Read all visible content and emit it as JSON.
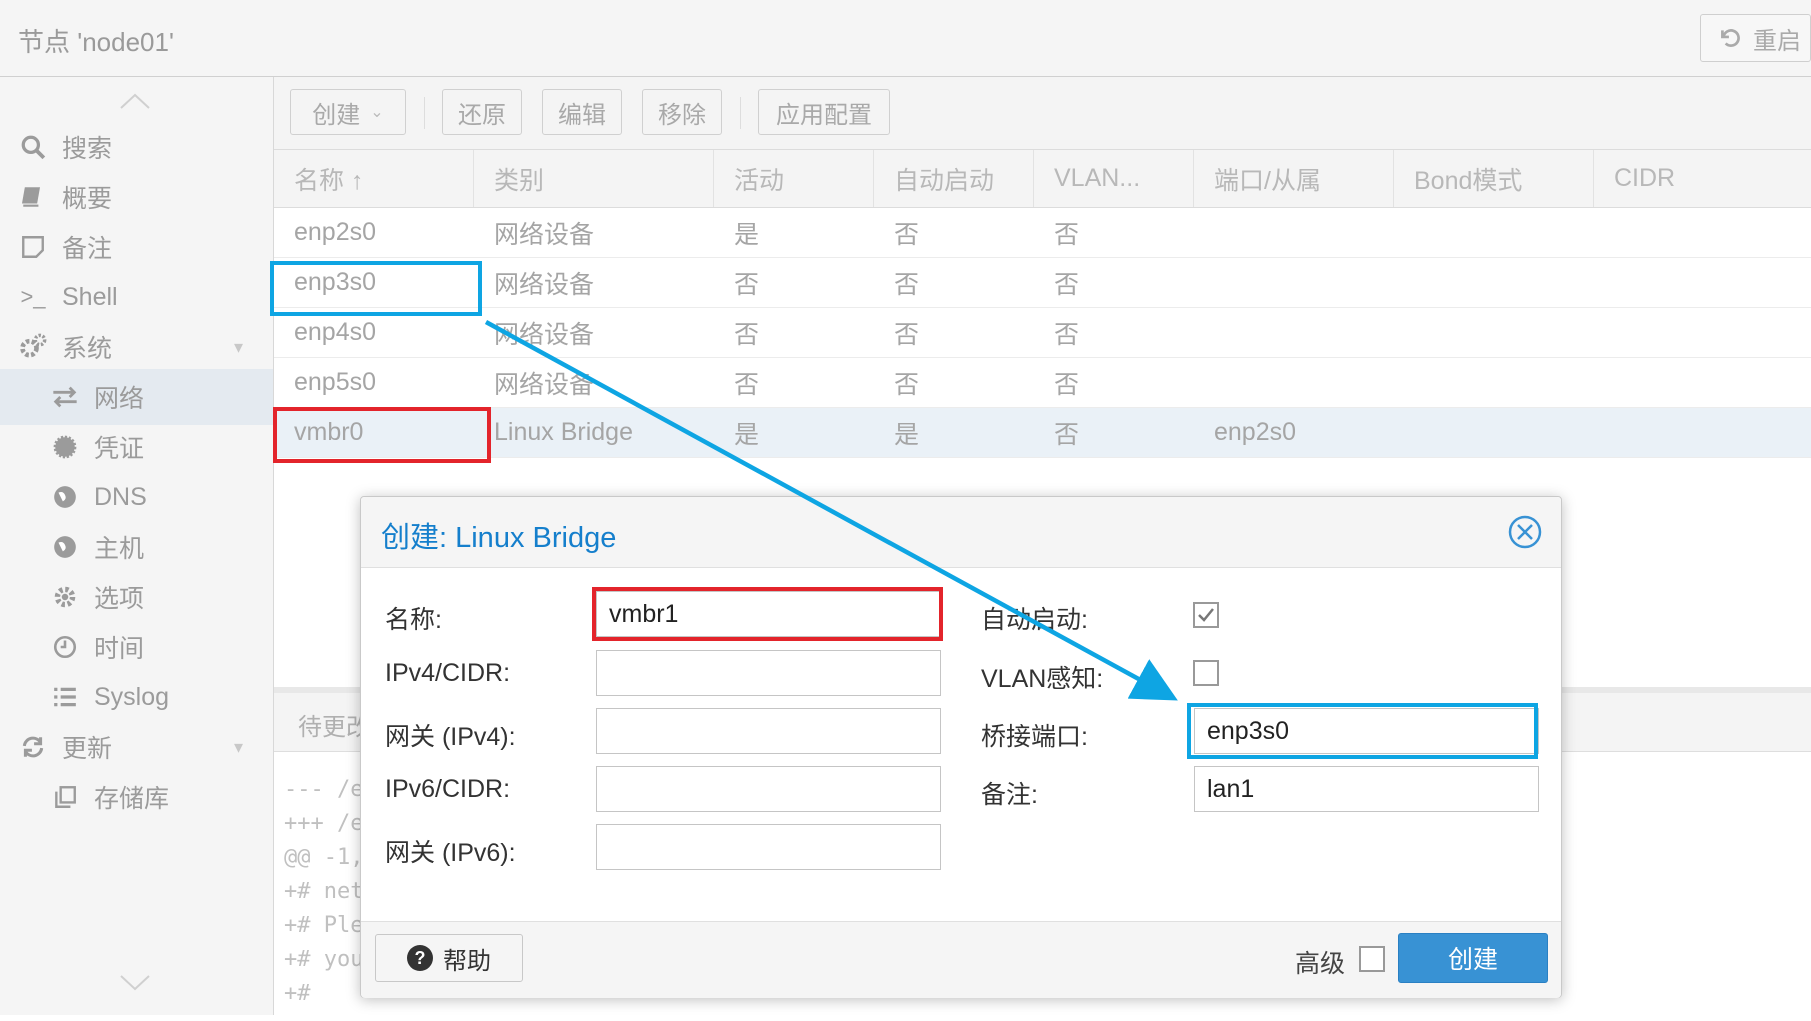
{
  "header": {
    "node_title": "节点 'node01'",
    "reboot_label": "重启"
  },
  "sidebar": {
    "items": [
      {
        "label": "搜索",
        "icon": "search-icon"
      },
      {
        "label": "概要",
        "icon": "book-icon"
      },
      {
        "label": "备注",
        "icon": "note-icon"
      },
      {
        "label": "Shell",
        "icon": "terminal-icon"
      },
      {
        "label": "系统",
        "icon": "gears-icon"
      },
      {
        "label": "网络",
        "icon": "exchange-icon"
      },
      {
        "label": "凭证",
        "icon": "certificate-icon"
      },
      {
        "label": "DNS",
        "icon": "globe-icon"
      },
      {
        "label": "主机",
        "icon": "globe-icon"
      },
      {
        "label": "选项",
        "icon": "gear-icon"
      },
      {
        "label": "时间",
        "icon": "clock-icon"
      },
      {
        "label": "Syslog",
        "icon": "list-icon"
      },
      {
        "label": "更新",
        "icon": "refresh-icon"
      },
      {
        "label": "存储库",
        "icon": "copy-icon"
      }
    ],
    "active": "网络"
  },
  "toolbar": {
    "create_label": "创建",
    "revert_label": "还原",
    "edit_label": "编辑",
    "remove_label": "移除",
    "apply_label": "应用配置"
  },
  "grid": {
    "columns": [
      "名称 ↑",
      "类别",
      "活动",
      "自动启动",
      "VLAN...",
      "端口/从属",
      "Bond模式",
      "CIDR"
    ],
    "rows": [
      {
        "name": "enp2s0",
        "type": "网络设备",
        "active": "是",
        "autostart": "否",
        "vlan": "否",
        "ports": ""
      },
      {
        "name": "enp3s0",
        "type": "网络设备",
        "active": "否",
        "autostart": "否",
        "vlan": "否",
        "ports": ""
      },
      {
        "name": "enp4s0",
        "type": "网络设备",
        "active": "否",
        "autostart": "否",
        "vlan": "否",
        "ports": ""
      },
      {
        "name": "enp5s0",
        "type": "网络设备",
        "active": "否",
        "autostart": "否",
        "vlan": "否",
        "ports": ""
      },
      {
        "name": "vmbr0",
        "type": "Linux Bridge",
        "active": "是",
        "autostart": "是",
        "vlan": "否",
        "ports": "enp2s0"
      }
    ]
  },
  "pending": {
    "title": "待更改",
    "lines": [
      "--- /e",
      "+++ /e",
      "@@ -1,",
      "+# net",
      "+# Ple",
      "+# you",
      "+#"
    ]
  },
  "dialog": {
    "title": "创建: Linux Bridge",
    "name_label": "名称:",
    "name_value": "vmbr1",
    "ipv4_label": "IPv4/CIDR:",
    "ipv4_value": "",
    "gw4_label": "网关 (IPv4):",
    "gw4_value": "",
    "ipv6_label": "IPv6/CIDR:",
    "ipv6_value": "",
    "gw6_label": "网关 (IPv6):",
    "gw6_value": "",
    "autostart_label": "自动启动:",
    "autostart_checked": true,
    "vlan_label": "VLAN感知:",
    "vlan_checked": false,
    "bridge_ports_label": "桥接端口:",
    "bridge_ports_value": "enp3s0",
    "comment_label": "备注:",
    "comment_value": "lan1",
    "help_label": "帮助",
    "advanced_label": "高级",
    "create_label": "创建"
  },
  "colors": {
    "accent": "#157fcc",
    "button_blue": "#3892d4",
    "highlight_blue": "#0ea5e3",
    "highlight_red": "#e3242b"
  }
}
